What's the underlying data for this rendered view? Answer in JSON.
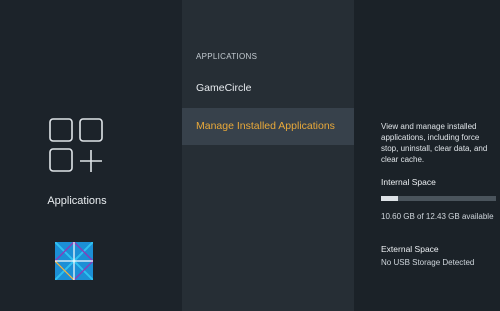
{
  "sidebar": {
    "icon": "apps-grid-plus-icon",
    "label": "Applications"
  },
  "menu": {
    "heading": "APPLICATIONS",
    "items": [
      {
        "label": "GameCircle",
        "selected": false
      },
      {
        "label": "Manage Installed Applications",
        "selected": true
      }
    ],
    "selected_color": "#e9a93a"
  },
  "details": {
    "description": "View and manage installed applications, including force stop, uninstall, clear data, and clear cache.",
    "internal_space": {
      "title": "Internal Space",
      "value": "10.60 GB of 12.43 GB available",
      "used_fraction": 0.15
    },
    "external_space": {
      "title": "External Space",
      "value": "No USB Storage Detected"
    }
  },
  "watermark": {
    "icon": "windows-logo-icon",
    "color": "#1c8fd6"
  }
}
